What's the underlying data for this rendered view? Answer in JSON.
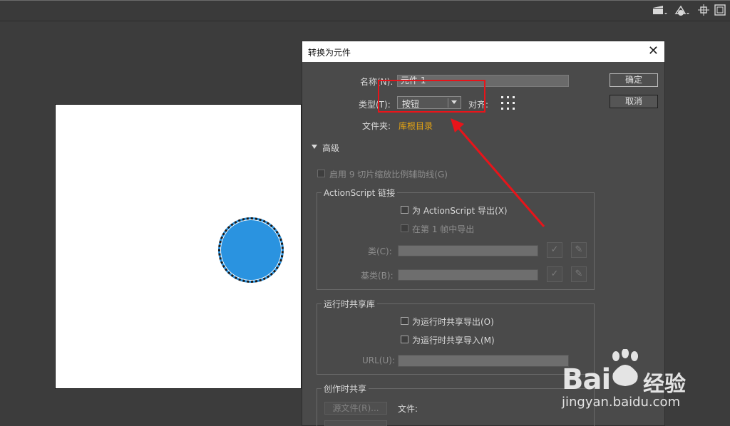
{
  "dialog": {
    "title": "转换为元件",
    "close_icon": "close-icon",
    "name_label": "名称(N):",
    "name_value": "元件 1",
    "type_label": "类型(T):",
    "type_value": "按钮",
    "align_label": "对齐:",
    "folder_label": "文件夹:",
    "folder_link": "库根目录",
    "ok_label": "确定",
    "cancel_label": "取消",
    "advanced_label": "高级",
    "nine_slice_label": "启用 9 切片缩放比例辅助线(G)",
    "actionscript": {
      "group_title": "ActionScript 链接",
      "export_as": "为 ActionScript 导出(X)",
      "export_frame": "在第 1 帧中导出",
      "class_label": "类(C):",
      "base_class_label": "基类(B):"
    },
    "runtime": {
      "group_title": "运行时共享库",
      "export_runtime": "为运行时共享导出(O)",
      "import_runtime": "为运行时共享导入(M)",
      "url_label": "URL(U):"
    },
    "authortime": {
      "group_title": "创作时共享",
      "source_button": "源文件(R)...",
      "file_label": "文件:"
    }
  },
  "watermark": {
    "brand": "Bai",
    "brand_cn": "经验",
    "url": "jingyan.baidu.com"
  },
  "annotation": {
    "color": "#e8141a"
  }
}
